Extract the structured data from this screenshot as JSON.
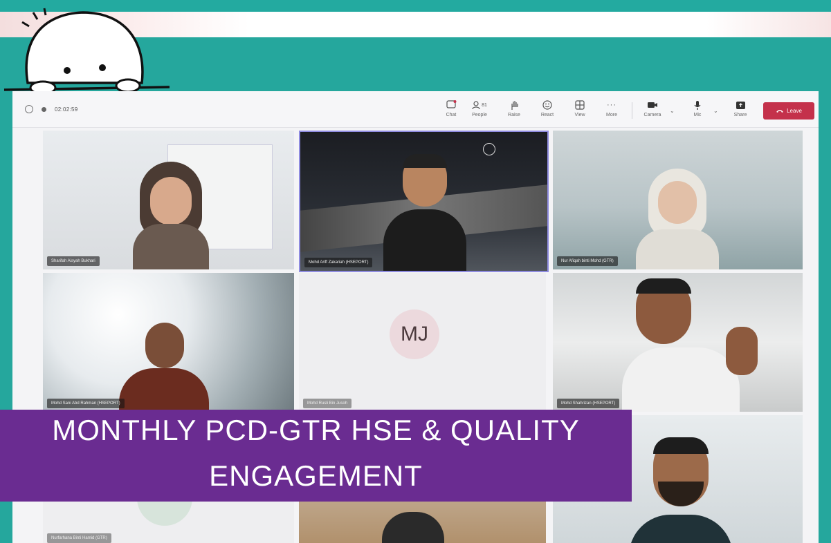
{
  "meeting": {
    "timer": "02:02:59",
    "toolbar": [
      {
        "id": "chat",
        "label": "Chat",
        "icon": "chat-icon"
      },
      {
        "id": "people",
        "label": "People",
        "icon": "people-icon",
        "count": "81"
      },
      {
        "id": "raise",
        "label": "Raise",
        "icon": "raise-hand-icon"
      },
      {
        "id": "react",
        "label": "React",
        "icon": "react-icon"
      },
      {
        "id": "view",
        "label": "View",
        "icon": "view-grid-icon"
      },
      {
        "id": "more",
        "label": "More",
        "icon": "more-icon"
      },
      {
        "id": "camera",
        "label": "Camera",
        "icon": "camera-icon"
      },
      {
        "id": "mic",
        "label": "Mic",
        "icon": "mic-icon"
      },
      {
        "id": "share",
        "label": "Share",
        "icon": "share-icon"
      }
    ],
    "leave_label": "Leave"
  },
  "participants": {
    "p1": {
      "name": "Sharifah Aisyah Bukhari"
    },
    "p2": {
      "name": "Mohd Ariff Zakariah (HSEPORT)"
    },
    "p3": {
      "name": "Nur Afiqah binti Mohd (GTR)"
    },
    "p4": {
      "name": "Mohd Sani Abd Rahman (HSEPORT)"
    },
    "p5": {
      "name": "Mohd Rusli Bin Jusoh",
      "initials": "MJ"
    },
    "p6": {
      "name": "Mohd Shahrizan (HSEPORT)"
    },
    "p7": {
      "name": "Nurfarhana Binti Hamid (GTR)"
    }
  },
  "banner": {
    "line1": "MONTHLY PCD-GTR HSE & QUALITY",
    "line2": "ENGAGEMENT"
  },
  "colors": {
    "teal": "#25a79d",
    "banner": "#6a2c91",
    "leave": "#c4314b"
  }
}
